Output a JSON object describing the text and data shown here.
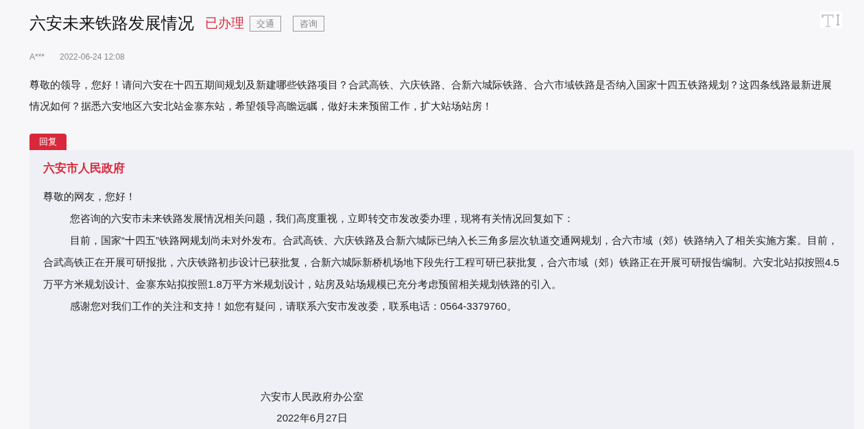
{
  "title": "六安未来铁路发展情况",
  "status": "已办理",
  "tags": [
    "交通",
    "咨询"
  ],
  "author": "A***",
  "date": "2022-06-24 12:08",
  "question": "尊敬的领导，您好！请问六安在十四五期间规划及新建哪些铁路项目？合武高铁、六庆铁路、合新六城际铁路、合六市域铁路是否纳入国家十四五铁路规划？这四条线路最新进展情况如何？据悉六安地区六安北站金寨东站，希望领导高瞻远瞩，做好未来预留工作，扩大站场站房！",
  "reply": {
    "tab": "回复",
    "org": "六安市人民政府",
    "paragraphs": [
      {
        "kind": "greeting",
        "text": "尊敬的网友，您好！"
      },
      {
        "kind": "indented",
        "text": "您咨询的六安市未来铁路发展情况相关问题，我们高度重视，立即转交市发改委办理，现将有关情况回复如下："
      },
      {
        "kind": "indented",
        "text": "目前，国家“十四五”铁路网规划尚未对外发布。合武高铁、六庆铁路及合新六城际已纳入长三角多层次轨道交通网规划，合六市域（郊）铁路纳入了相关实施方案。目前，合武高铁正在开展可研报批，六庆铁路初步设计已获批复，合新六城际新桥机场地下段先行工程可研已获批复，合六市域（郊）铁路正在开展可研报告编制。六安北站拟按照4.5万平方米规划设计、金寨东站拟按照1.8万平方米规划设计，站房及站场规模已充分考虑预留相关规划铁路的引入。"
      },
      {
        "kind": "indented",
        "text": "感谢您对我们工作的关注和支持！如您有疑问，请联系六安市发改委，联系电话：0564-3379760。"
      }
    ],
    "signature": "六安市人民政府办公室",
    "signature_date": "2022年6月27日"
  }
}
